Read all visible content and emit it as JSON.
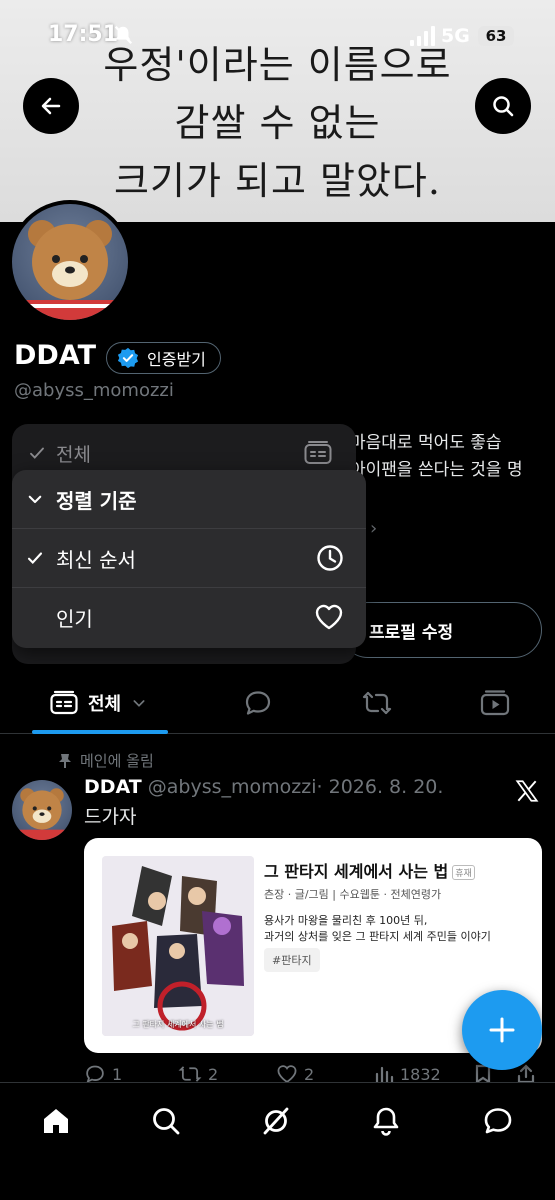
{
  "status_bar": {
    "time": "17:51",
    "network": "5G",
    "battery": "63"
  },
  "banner": {
    "lines": [
      "우정'이라는 이름으로",
      "감쌀 수 없는",
      "크기가 되고 말았다."
    ]
  },
  "profile": {
    "name": "DDAT",
    "verify_label": "인증받기",
    "handle": "@abyss_momozzi",
    "bio_lines": [
      "마음대로 먹어도 좋습",
      "아이팬을 쓴다는 것을 명"
    ],
    "edit_label": "프로필 수정"
  },
  "back_menu": {
    "label": "전체"
  },
  "sort_menu": {
    "header": "정렬 기준",
    "options": [
      {
        "label": "최신 순서",
        "checked": true,
        "icon": "clock-icon"
      },
      {
        "label": "인기",
        "checked": false,
        "icon": "heart-icon"
      }
    ]
  },
  "tabs": [
    {
      "label": "전체",
      "icon": "feed-icon",
      "active": true
    },
    {
      "label": "",
      "icon": "reply-icon"
    },
    {
      "label": "",
      "icon": "repost-icon"
    },
    {
      "label": "",
      "icon": "media-icon"
    }
  ],
  "post": {
    "pinned_label": "메인에 올림",
    "author_name": "DDAT",
    "author_handle": "@abyss_momozzi",
    "date": "· 2026. 8. 20.",
    "text": "드가자",
    "card": {
      "title": "그 판타지 세계에서 사는 법",
      "badge": "휴재",
      "meta": "츤장 · 글/그림 | 수요웹툰 · 전체연령가",
      "desc_lines": [
        "용사가 마왕을 물리친 후 100년 뒤,",
        "과거의 상처를 잊은 그 판타지 세계 주민들 이야기"
      ],
      "tag": "#판타지",
      "cover_caption": "그 판타지 세계에서 사는 법"
    },
    "stats": {
      "replies": "1",
      "reposts": "2",
      "likes": "2",
      "views": "1832"
    }
  },
  "colors": {
    "accent": "#1d9bf0",
    "bg": "#000000",
    "muted": "#71767b",
    "menu": "#2c2c2e"
  }
}
